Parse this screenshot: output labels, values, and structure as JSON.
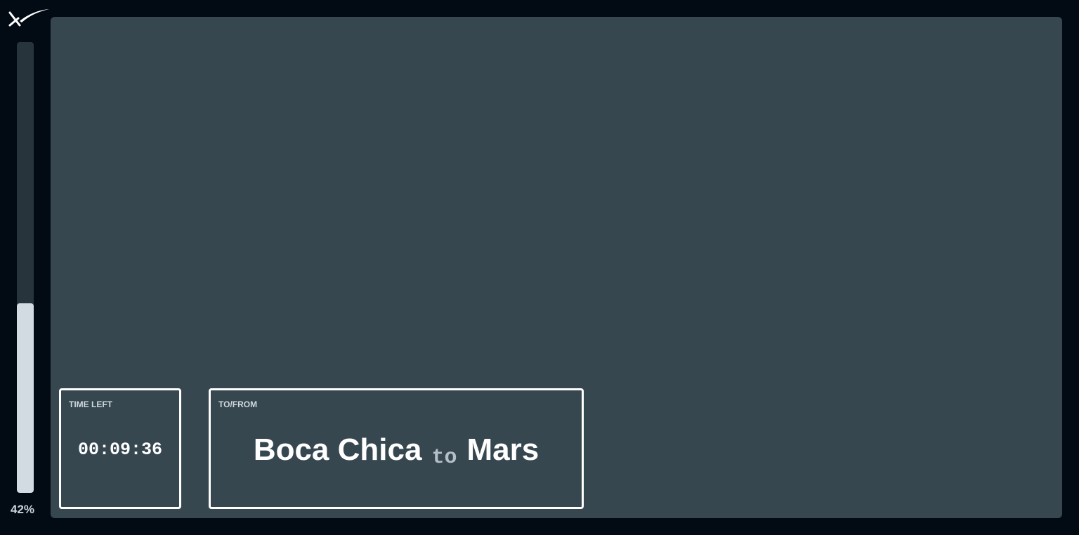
{
  "branding": {
    "logo_icon": "x-swoosh-logo-icon"
  },
  "progress": {
    "value": 0.42,
    "label": "42%"
  },
  "time_left": {
    "label": "TIME LEFT",
    "value": "00:09:36"
  },
  "route": {
    "label": "TO/FROM",
    "from": "Boca Chica",
    "separator": "to",
    "to": "Mars"
  },
  "colors": {
    "background": "#020b14",
    "viewport": "#37474f",
    "progress_track": "#28343c",
    "progress_fill": "#d2dbe1",
    "card_border": "#ffffff"
  }
}
